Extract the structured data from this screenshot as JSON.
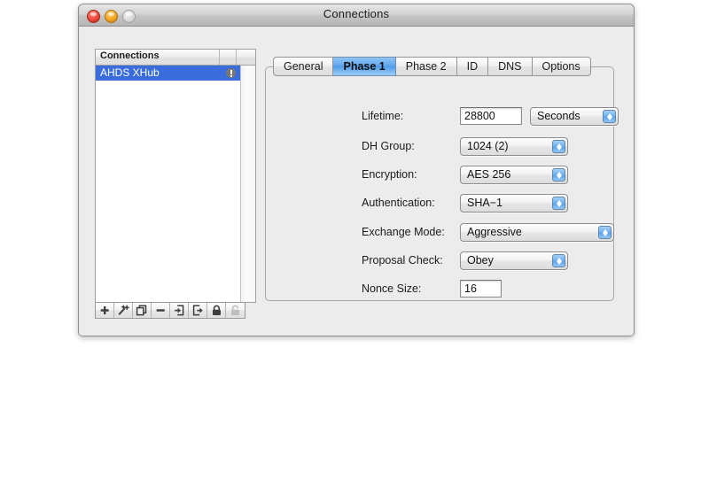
{
  "window": {
    "title": "Connections",
    "traffic_lights": [
      "close",
      "minimize",
      "zoom"
    ]
  },
  "sidebar": {
    "header": "Connections",
    "rows": [
      {
        "label": "AHDS XHub",
        "selected": true,
        "alert_icon": "alert-exclamation-icon"
      }
    ],
    "toolbar": [
      {
        "name": "add-button",
        "icon": "plus-icon",
        "enabled": true
      },
      {
        "name": "add-from-template-button",
        "icon": "magic-wand-plus-icon",
        "enabled": true
      },
      {
        "name": "duplicate-button",
        "icon": "duplicate-icon",
        "enabled": true
      },
      {
        "name": "remove-button",
        "icon": "minus-icon",
        "enabled": true
      },
      {
        "name": "import-button",
        "icon": "arrow-into-box-icon",
        "enabled": true
      },
      {
        "name": "export-button",
        "icon": "arrow-out-of-box-icon",
        "enabled": true
      },
      {
        "name": "lock-button",
        "icon": "lock-closed-icon",
        "enabled": true
      },
      {
        "name": "unlock-button",
        "icon": "lock-open-icon",
        "enabled": false
      }
    ]
  },
  "tabs": [
    {
      "label": "General",
      "active": false
    },
    {
      "label": "Phase 1",
      "active": true
    },
    {
      "label": "Phase 2",
      "active": false
    },
    {
      "label": "ID",
      "active": false
    },
    {
      "label": "DNS",
      "active": false
    },
    {
      "label": "Options",
      "active": false
    }
  ],
  "form": {
    "lifetime": {
      "label": "Lifetime:",
      "value": "28800",
      "unit": "Seconds"
    },
    "dh_group": {
      "label": "DH Group:",
      "value": "1024 (2)"
    },
    "encryption": {
      "label": "Encryption:",
      "value": "AES 256"
    },
    "authentication": {
      "label": "Authentication:",
      "value": "SHA−1"
    },
    "exchange_mode": {
      "label": "Exchange Mode:",
      "value": "Aggressive"
    },
    "proposal_check": {
      "label": "Proposal Check:",
      "value": "Obey"
    },
    "nonce_size": {
      "label": "Nonce Size:",
      "value": "16"
    }
  },
  "colors": {
    "selection_blue": "#3a6ddb",
    "active_tab_blue": "#4f9bea",
    "window_bg": "#ececec",
    "alert_grey": "#777777"
  }
}
